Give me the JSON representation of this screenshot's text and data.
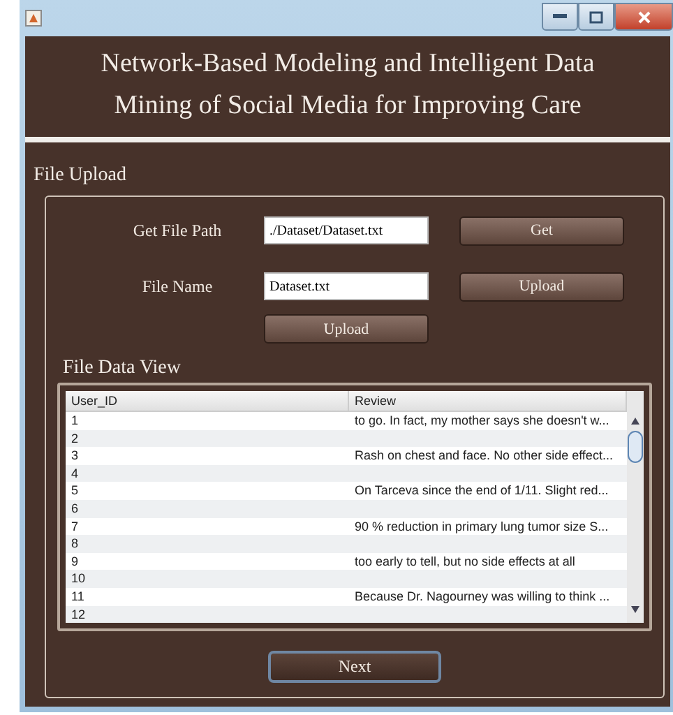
{
  "window": {
    "title_lines": [
      "Network-Based Modeling and Intelligent Data",
      "Mining of Social Media for Improving Care"
    ]
  },
  "file_upload": {
    "heading": "File Upload",
    "fields": [
      {
        "label": "Get File Path",
        "value": "./Dataset/Dataset.txt",
        "button": "Get"
      },
      {
        "label": "File Name",
        "value": "Dataset.txt",
        "button": "Upload"
      }
    ],
    "upload_button": "Upload"
  },
  "file_data_view": {
    "heading": "File Data View",
    "table": {
      "columns": [
        "User_ID",
        "Review"
      ],
      "rows": [
        [
          "1",
          "to go. In fact, my mother says she doesn't w..."
        ],
        [
          "2",
          ""
        ],
        [
          "3",
          "Rash on chest and face. No other side effect..."
        ],
        [
          "4",
          ""
        ],
        [
          "5",
          "On Tarceva since the end of 1/11. Slight red..."
        ],
        [
          "6",
          ""
        ],
        [
          "7",
          "90 % reduction in primary lung tumor size S..."
        ],
        [
          "8",
          ""
        ],
        [
          "9",
          "too early to tell, but no side effects at all"
        ],
        [
          "10",
          ""
        ],
        [
          "11",
          "Because Dr. Nagourney was willing to think ..."
        ],
        [
          "12",
          ""
        ]
      ]
    }
  },
  "next_button": "Next"
}
